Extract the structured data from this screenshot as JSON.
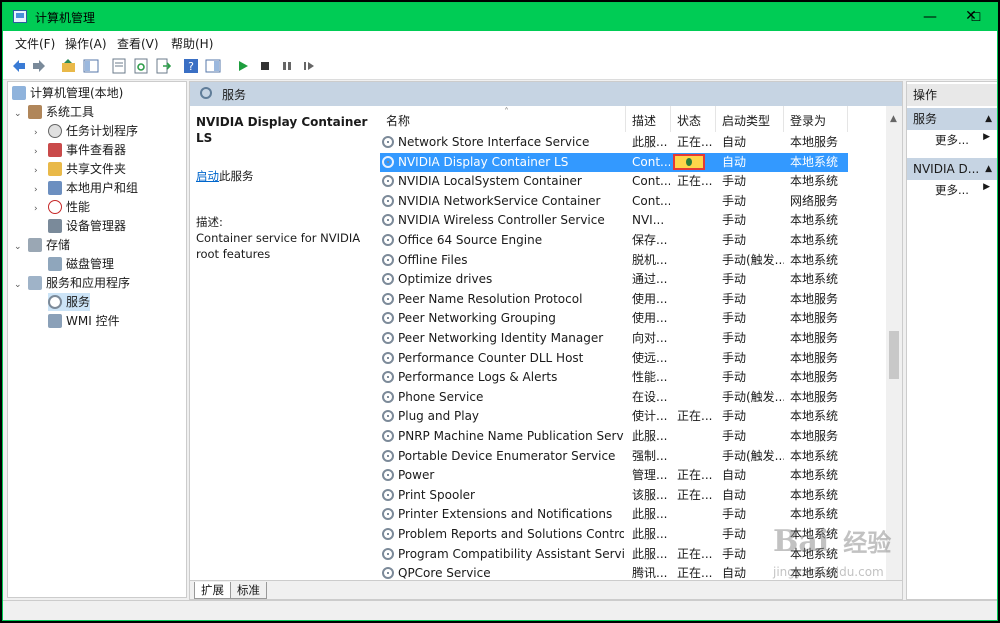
{
  "window": {
    "title": "计算机管理",
    "controls": {
      "minimize": "—",
      "maximize": "☐",
      "close": "✕"
    }
  },
  "menu": [
    "文件(F)",
    "操作(A)",
    "查看(V)",
    "帮助(H)"
  ],
  "toolbar": {
    "icons": [
      "back-icon",
      "forward-icon",
      "up-icon",
      "show-hide-tree-icon",
      "properties-icon",
      "refresh-icon",
      "export-icon",
      "help-icon",
      "show-hide-action-icon",
      "start-service-icon",
      "stop-service-icon",
      "pause-service-icon",
      "resume-service-icon"
    ]
  },
  "tree": {
    "root": "计算机管理(本地)",
    "system_tools": "系统工具",
    "task_scheduler": "任务计划程序",
    "event_viewer": "事件查看器",
    "shared_folders": "共享文件夹",
    "local_users": "本地用户和组",
    "performance": "性能",
    "device_manager": "设备管理器",
    "storage": "存储",
    "disk_management": "磁盘管理",
    "services_apps": "服务和应用程序",
    "services": "服务",
    "wmi": "WMI 控件"
  },
  "services_panel": {
    "header": "服务",
    "selected_name": "NVIDIA Display Container LS",
    "start_link": "启动",
    "start_suffix": "此服务",
    "desc_label": "描述:",
    "desc_text": "Container service for NVIDIA root features"
  },
  "columns": {
    "name": "名称",
    "desc": "描述",
    "status": "状态",
    "startup": "启动类型",
    "logon": "登录为"
  },
  "services": [
    {
      "name": "Network Store Interface Service",
      "desc": "此服...",
      "status": "正在...",
      "startup": "自动",
      "logon": "本地服务"
    },
    {
      "name": "NVIDIA Display Container LS",
      "desc": "Cont...",
      "status": "",
      "startup": "自动",
      "logon": "本地系统"
    },
    {
      "name": "NVIDIA LocalSystem Container",
      "desc": "Cont...",
      "status": "正在...",
      "startup": "手动",
      "logon": "本地系统"
    },
    {
      "name": "NVIDIA NetworkService Container",
      "desc": "Cont...",
      "status": "",
      "startup": "手动",
      "logon": "网络服务"
    },
    {
      "name": "NVIDIA Wireless Controller Service",
      "desc": "NVI...",
      "status": "",
      "startup": "手动",
      "logon": "本地系统"
    },
    {
      "name": "Office 64 Source Engine",
      "desc": "保存...",
      "status": "",
      "startup": "手动",
      "logon": "本地系统"
    },
    {
      "name": "Offline Files",
      "desc": "脱机...",
      "status": "",
      "startup": "手动(触发...",
      "logon": "本地系统"
    },
    {
      "name": "Optimize drives",
      "desc": "通过...",
      "status": "",
      "startup": "手动",
      "logon": "本地系统"
    },
    {
      "name": "Peer Name Resolution Protocol",
      "desc": "使用...",
      "status": "",
      "startup": "手动",
      "logon": "本地服务"
    },
    {
      "name": "Peer Networking Grouping",
      "desc": "使用...",
      "status": "",
      "startup": "手动",
      "logon": "本地服务"
    },
    {
      "name": "Peer Networking Identity Manager",
      "desc": "向对...",
      "status": "",
      "startup": "手动",
      "logon": "本地服务"
    },
    {
      "name": "Performance Counter DLL Host",
      "desc": "使远...",
      "status": "",
      "startup": "手动",
      "logon": "本地服务"
    },
    {
      "name": "Performance Logs & Alerts",
      "desc": "性能...",
      "status": "",
      "startup": "手动",
      "logon": "本地服务"
    },
    {
      "name": "Phone Service",
      "desc": "在设...",
      "status": "",
      "startup": "手动(触发...",
      "logon": "本地服务"
    },
    {
      "name": "Plug and Play",
      "desc": "使计...",
      "status": "正在...",
      "startup": "手动",
      "logon": "本地系统"
    },
    {
      "name": "PNRP Machine Name Publication Service",
      "desc": "此服...",
      "status": "",
      "startup": "手动",
      "logon": "本地服务"
    },
    {
      "name": "Portable Device Enumerator Service",
      "desc": "强制...",
      "status": "",
      "startup": "手动(触发...",
      "logon": "本地系统"
    },
    {
      "name": "Power",
      "desc": "管理...",
      "status": "正在...",
      "startup": "自动",
      "logon": "本地系统"
    },
    {
      "name": "Print Spooler",
      "desc": "该服...",
      "status": "正在...",
      "startup": "自动",
      "logon": "本地系统"
    },
    {
      "name": "Printer Extensions and Notifications",
      "desc": "此服...",
      "status": "",
      "startup": "手动",
      "logon": "本地系统"
    },
    {
      "name": "Problem Reports and Solutions Control...",
      "desc": "此服...",
      "status": "",
      "startup": "手动",
      "logon": "本地系统"
    },
    {
      "name": "Program Compatibility Assistant Service",
      "desc": "此服...",
      "status": "正在...",
      "startup": "手动",
      "logon": "本地系统"
    },
    {
      "name": "QPCore Service",
      "desc": "腾讯...",
      "status": "正在...",
      "startup": "自动",
      "logon": "本地系统"
    }
  ],
  "tabs": [
    "扩展",
    "标准"
  ],
  "actions": {
    "header": "操作",
    "section1": "服务",
    "more1": "更多...",
    "section2": "NVIDIA D...",
    "more2": "更多..."
  },
  "watermark": {
    "brand": "Bai",
    "suffix": "经验",
    "url": "jingyan.baidu.com"
  },
  "colors": {
    "title_bar": "#00cc55",
    "selection": "#3399ff",
    "section": "#c6d4e3",
    "highlight_box": "#e53935"
  }
}
